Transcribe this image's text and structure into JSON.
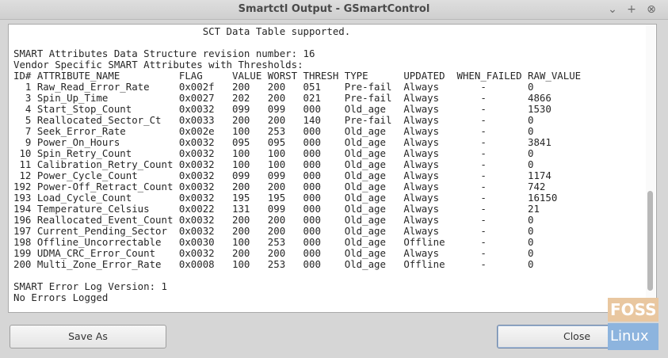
{
  "window": {
    "title": "Smartctl Output - GSmartControl"
  },
  "output_lines": [
    "                                SCT Data Table supported.",
    "",
    "SMART Attributes Data Structure revision number: 16",
    "Vendor Specific SMART Attributes with Thresholds:",
    "ID# ATTRIBUTE_NAME          FLAG     VALUE WORST THRESH TYPE      UPDATED  WHEN_FAILED RAW_VALUE",
    "  1 Raw_Read_Error_Rate     0x002f   200   200   051    Pre-fail  Always       -       0",
    "  3 Spin_Up_Time            0x0027   202   200   021    Pre-fail  Always       -       4866",
    "  4 Start_Stop_Count        0x0032   099   099   000    Old_age   Always       -       1530",
    "  5 Reallocated_Sector_Ct   0x0033   200   200   140    Pre-fail  Always       -       0",
    "  7 Seek_Error_Rate         0x002e   100   253   000    Old_age   Always       -       0",
    "  9 Power_On_Hours          0x0032   095   095   000    Old_age   Always       -       3841",
    " 10 Spin_Retry_Count        0x0032   100   100   000    Old_age   Always       -       0",
    " 11 Calibration_Retry_Count 0x0032   100   100   000    Old_age   Always       -       0",
    " 12 Power_Cycle_Count       0x0032   099   099   000    Old_age   Always       -       1174",
    "192 Power-Off_Retract_Count 0x0032   200   200   000    Old_age   Always       -       742",
    "193 Load_Cycle_Count        0x0032   195   195   000    Old_age   Always       -       16150",
    "194 Temperature_Celsius     0x0022   131   099   000    Old_age   Always       -       21",
    "196 Reallocated_Event_Count 0x0032   200   200   000    Old_age   Always       -       0",
    "197 Current_Pending_Sector  0x0032   200   200   000    Old_age   Always       -       0",
    "198 Offline_Uncorrectable   0x0030   100   253   000    Old_age   Offline      -       0",
    "199 UDMA_CRC_Error_Count    0x0032   200   200   000    Old_age   Always       -       0",
    "200 Multi_Zone_Error_Rate   0x0008   100   253   000    Old_age   Offline      -       0",
    "",
    "SMART Error Log Version: 1",
    "No Errors Logged"
  ],
  "buttons": {
    "save_as": "Save As",
    "close": "Close"
  },
  "logo": {
    "top": "FOSS",
    "bottom": "Linux"
  },
  "window_controls": {
    "minimize": "⌄",
    "maximize": "+",
    "close": "⊗"
  }
}
